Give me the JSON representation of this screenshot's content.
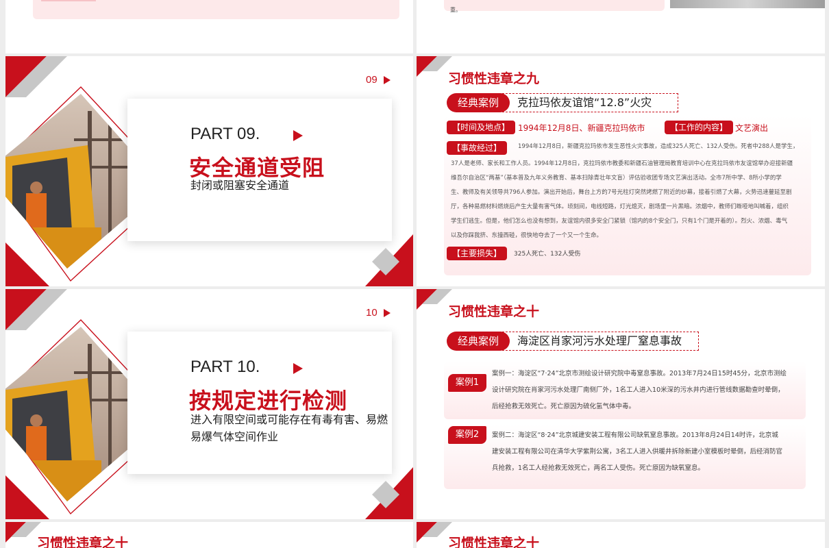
{
  "colors": {
    "accent": "#c8101c",
    "panel_pink": "#fde9ea",
    "gray_shape": "#cfcfcf"
  },
  "top_right_partial": {
    "text": "重。"
  },
  "part9": {
    "page_num": "09",
    "part_label": "PART 09.",
    "title": "安全通道受阻",
    "subtitle": "封闭或阻塞安全通道"
  },
  "part10": {
    "page_num": "10",
    "part_label": "PART 10.",
    "title": "按规定进行检测",
    "subtitle": "进入有限空间或可能存在有毒有害、易燃易爆气体空间作业"
  },
  "slide_nine": {
    "title": "习惯性违章之九",
    "case_pill": "经典案例",
    "case_name": "克拉玛依友谊馆“12.8”火灾",
    "time_tag": "【时间及地点】",
    "time_value": "1994年12月8日、新疆克拉玛依市",
    "work_tag": "【工作的内容】",
    "work_value": "文艺演出",
    "process_tag": "【事故经过】",
    "process_lines": [
      "1994年12月8日，新疆克拉玛依市发生恶性火灾事故，造成325人死亡、132人受伤。死者中288人是学生，",
      "37人是老师、家长和工作人员。1994年12月8日，克拉玛依市教委和新疆石油管理局教育培训中心在克拉玛依市友谊馆举办迎接新疆",
      "维吾尔自治区“两基”（基本普及九年义务教育、基本扫除青壮年文盲）评估验收团专场文艺演出活动。全市7所中学、8所小学的学",
      "生、教师及有关领导共796人参加。演出开始后，舞台上方的7号光柱灯突然烤燃了附近的纱幕，接着引燃了大幕，火势迅速蔓延至剧",
      "厅，各种易燃材料燃烧后产生大量有害气体。顷刻间，电线短路，灯光熄灭，剧场里一片黑暗。浓烟中，教师们嘶哑地叫喊着，组织",
      "学生们逃生。但是，他们怎么也没有想到，友谊馆内很多安全门紧锁（馆内的8个安全门，只有1个门是开着的）。烈火、浓烟、毒气",
      "以及你踩我挤、东撞西碰，很快地夺去了一个又一个生命。"
    ],
    "loss_tag": "【主要损失】",
    "loss_value": "325人死亡、132人受伤"
  },
  "slide_ten": {
    "title": "习惯性违章之十",
    "case_pill": "经典案例",
    "case_name": "海淀区肖家河污水处理厂窒息事故",
    "cases": [
      {
        "label": "案例1",
        "lines": [
          "案例一：海淀区“7·24”北京市测绘设计研究院中毒窒息事故。2013年7月24日15时45分，北京市测绘",
          "设计研究院在肖家河污水处理厂南侧厂外，1名工人进入10米深的污水井内进行管线数据勘查时晕倒，",
          "后经抢救无效死亡。死亡原因为硫化氢气体中毒。"
        ]
      },
      {
        "label": "案例2",
        "lines": [
          "案例二：海淀区“8·24”北京城建安装工程有限公司缺氧窒息事故。2013年8月24日14时许，北京城",
          "建安装工程有限公司在清华大学紫荆公寓，3名工人进入供暖井拆除新建小室模板时晕倒，后经消防官",
          "兵抢救，1名工人经抢救无效死亡，两名工人受伤。死亡原因为缺氧窒息。"
        ]
      }
    ]
  },
  "bottom_left": {
    "title": "习惯性违章之十"
  },
  "bottom_right": {
    "title": "习惯性违章之十"
  }
}
